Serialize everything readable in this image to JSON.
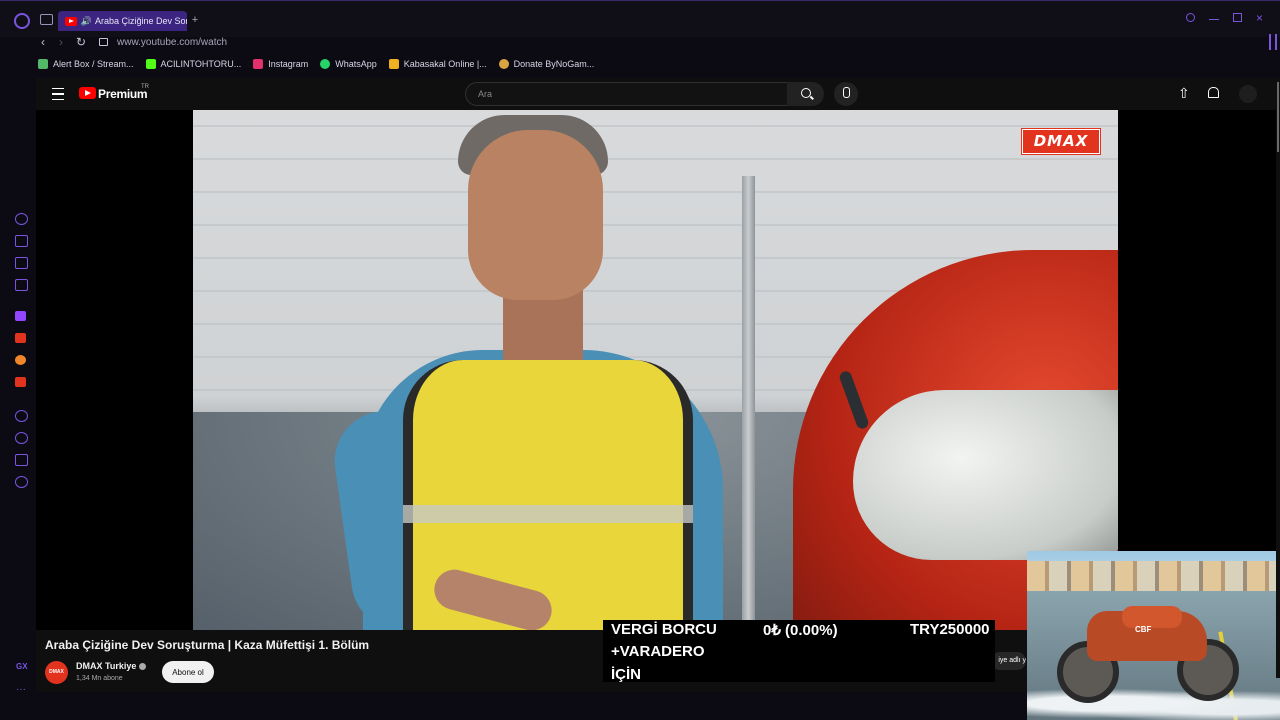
{
  "browser": {
    "tab_title": "Araba Çiziğine Dev Sor",
    "tab_audio_icon": "🔊",
    "new_tab_icon": "+",
    "url": "www.youtube.com/watch",
    "nav_back_icon": "‹",
    "nav_forward_icon": "›",
    "nav_reload_icon": "↻",
    "bookmarks": [
      {
        "label": "Alert Box / Stream...",
        "icon_color": "#53b96a"
      },
      {
        "label": "ACILINTOHTORU...",
        "icon_color": "#53fc18"
      },
      {
        "label": "Instagram",
        "icon_color": "#e1306c"
      },
      {
        "label": "WhatsApp",
        "icon_color": "#25d366"
      },
      {
        "label": "Kabasakal Online |...",
        "icon_color": "#f0b020"
      },
      {
        "label": "Donate ByNoGam...",
        "icon_color": "#d9a441"
      }
    ],
    "sidebar_icon_colors": [
      "#7a55e0",
      "#7a55e0",
      "#7a55e0",
      "#7a55e0",
      "#9146ff",
      "#e2331f",
      "#f0862a",
      "#e2331f",
      "#7a55e0",
      "#7a55e0",
      "#7a55e0",
      "#7a55e0"
    ],
    "gx_label": "GX",
    "more_label": "···"
  },
  "youtube": {
    "logo_text": "Premium",
    "logo_country": "TR",
    "search_placeholder": "Ara",
    "upload_icon": "⇧",
    "channel_logo_text": "DMAX",
    "video_title": "Araba Çiziğine Dev Soruşturma | Kaza Müfettişi 1. Bölüm",
    "channel_name": "DMAX Turkiye",
    "subscribers": "1,34 Mn abone",
    "subscribe_label": "Abone ol",
    "right_chip_text": "iye adlı y"
  },
  "video": {
    "watermark": "DMAX",
    "car_label": "CBF"
  },
  "ticker": {
    "line1": "VERGİ BORCU",
    "line2": "+VARADERO",
    "line3": "İÇİN",
    "change": "0₺ (0.00%)",
    "amount": "TRY250000"
  },
  "colors": {
    "accent": "#7a55e0",
    "tab_active": "#3b2580",
    "youtube_red": "#ff0000",
    "dmax_red": "#e2331f"
  }
}
